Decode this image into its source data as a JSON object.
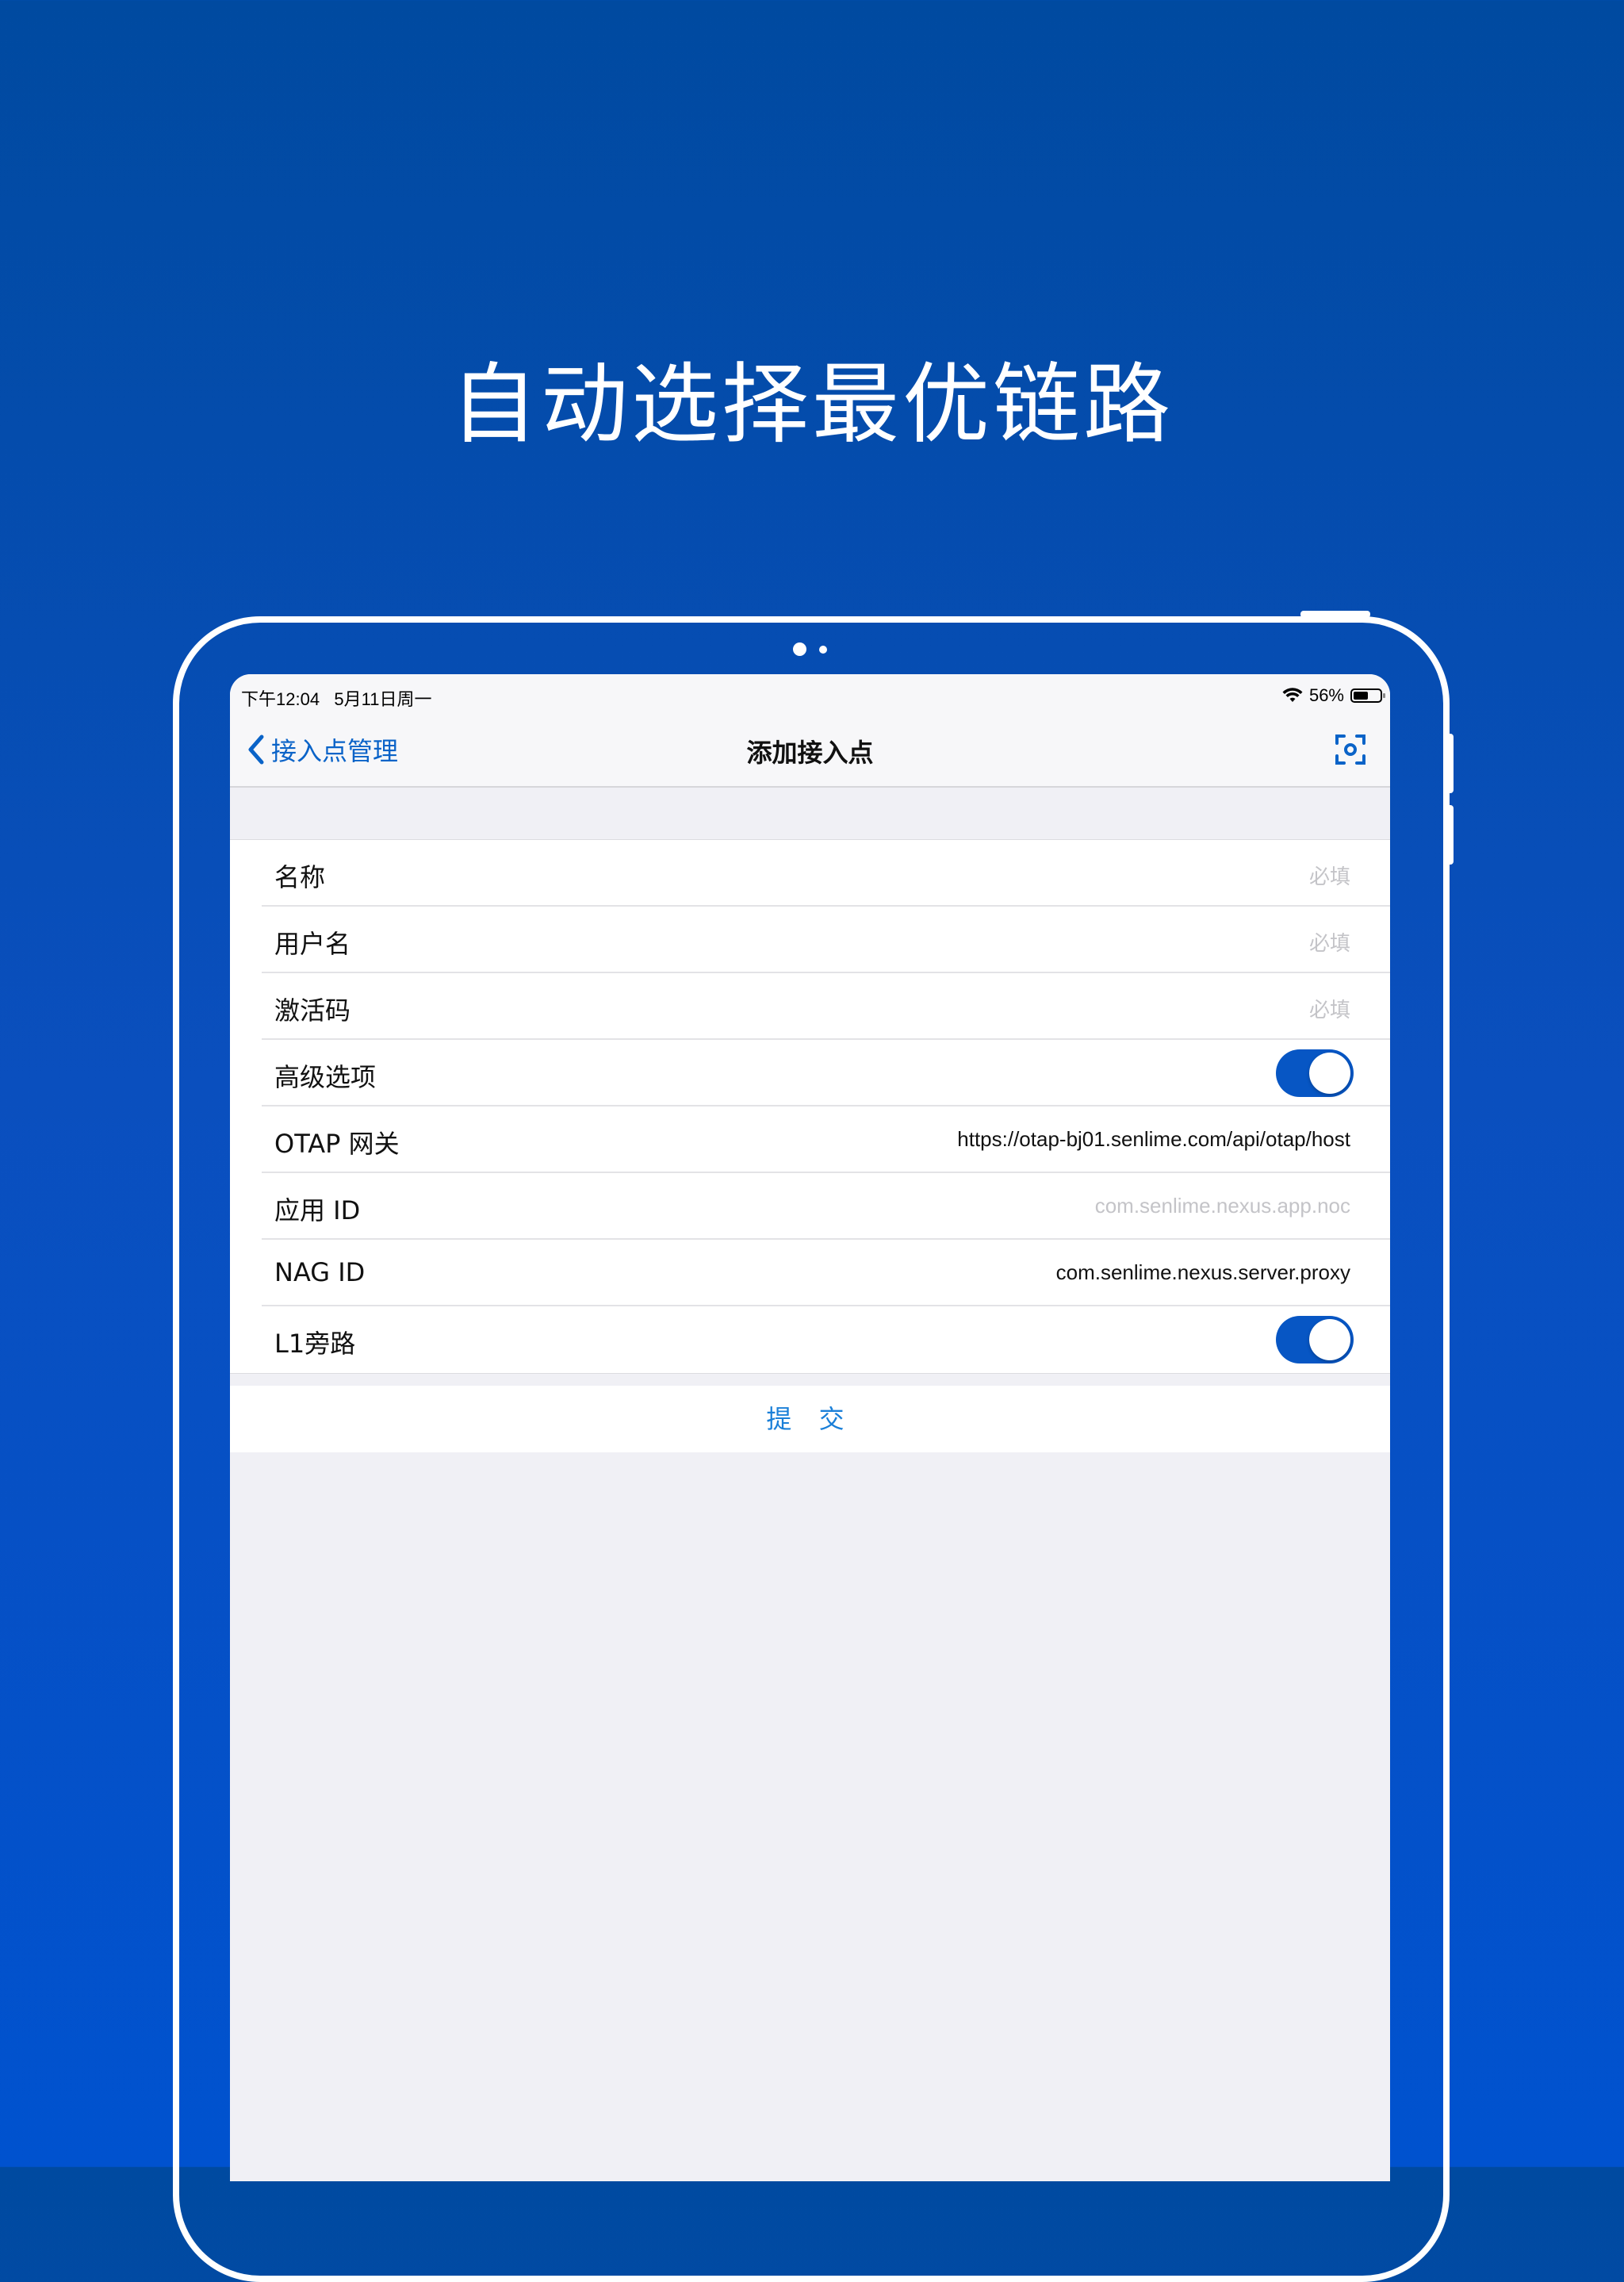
{
  "headline": "自动选择最优链路",
  "status_bar": {
    "time": "下午12:04",
    "date": "5月11日周一",
    "battery_text": "56%",
    "battery_level": 0.56
  },
  "nav": {
    "back_label": "接入点管理",
    "title": "添加接入点",
    "scan_icon": "scan-icon"
  },
  "form": {
    "rows": [
      {
        "label": "名称",
        "value": "必填",
        "type": "placeholder"
      },
      {
        "label": "用户名",
        "value": "必填",
        "type": "placeholder"
      },
      {
        "label": "激活码",
        "value": "必填",
        "type": "placeholder"
      },
      {
        "label": "高级选项",
        "type": "toggle",
        "on": true
      },
      {
        "label": "OTAP 网关",
        "value": "https://otap-bj01.senlime.com/api/otap/host",
        "type": "value"
      },
      {
        "label": "应用 ID",
        "value": "com.senlime.nexus.app.noc",
        "type": "placeholder"
      },
      {
        "label": "NAG ID",
        "value": "com.senlime.nexus.server.proxy",
        "type": "value"
      },
      {
        "label": "L1旁路",
        "type": "toggle",
        "on": true
      }
    ]
  },
  "submit_label": "提 交",
  "colors": {
    "accent": "#0a63c8",
    "toggle_on": "#0756c4",
    "background_top": "#004aa0",
    "background_bottom": "#0052cf"
  }
}
